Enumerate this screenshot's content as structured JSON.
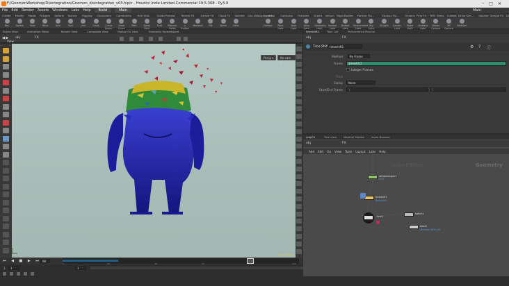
{
  "titlebar": {
    "text": "F:/GnomonWorkshop/Disintegration/Gnomon_disintegration_v03.hiplc - Houdini Indie Limited-Commercial 19.5.368 - Py3.9"
  },
  "menubar": {
    "items": [
      "File",
      "Edit",
      "Render",
      "Assets",
      "Windows",
      "Labs",
      "Help"
    ],
    "desktop": "Build",
    "desktop2": "Main"
  },
  "right_header": {
    "main_label": "Main"
  },
  "shelf_tabs_left": [
    "Create",
    "Modify",
    "Model",
    "Polygon",
    "Deform",
    "Texture",
    "Rigging",
    "Characters",
    "Constraints",
    "Hair Utils",
    "Guide Process",
    "Terrain FX",
    "Simple FX",
    "Cloud FX",
    "Volume",
    "Gas Utils",
    "python"
  ],
  "shelf_tabs_right": [
    "Lights and...",
    "Collisions",
    "Particles",
    "Grains",
    "Vellum",
    "Rigid Bodies",
    "Particle Flu...",
    "Viscous Flu...",
    "Oceans",
    "Pyro FX",
    "FEM",
    "Wires",
    "Crowds",
    "Drive Sim...",
    "Volume",
    "Simple FX",
    "Legacy Pyr..."
  ],
  "shelf_tools_left": [
    "Box",
    "Sphere",
    "Tube",
    "Torus",
    "Grid",
    "Null",
    "Line",
    "Circle",
    "Curve Bezier",
    "Draw Curve",
    "Path",
    "Spray Paint",
    "Font",
    "Platonic Solids",
    "L-System",
    "Metaball",
    "File",
    "Spiral",
    "Helix"
  ],
  "shelf_tools_right": [
    "Camera",
    "Point Light",
    "Spot Light",
    "Area Light",
    "Geometry Light",
    "Volume Light",
    "Distant Light",
    "Environment Light",
    "Sky Light",
    "GI Light",
    "Caustic Light",
    "Portal Light",
    "Ambient Light",
    "Stereo Camera",
    "VR Camera",
    "Switcher"
  ],
  "pane_tabs_left": [
    "Scene View",
    "Animation Editor",
    "Render View",
    "Composite View",
    "Motion FX View",
    "Geometry Spreadsheet"
  ],
  "viewport": {
    "label": "View",
    "persp_button": "Persp ▾",
    "cam_button": "No cam ▾",
    "geo_label": "Geometry",
    "path_left": "obj",
    "path_right": "FX"
  },
  "param_tabs": [
    "timeshift1",
    "Take List",
    "Performance Monitor"
  ],
  "params": {
    "node_type": "Time Shift",
    "node_name": "timeshift1",
    "method_label": "Method",
    "method_value": "By Frame",
    "frame_label": "Frame",
    "frame_value": "$meshfs1",
    "integer_frames_label": "Integer Frames",
    "time_label": "Time",
    "clamp_label": "Clamp",
    "clamp_value": "None",
    "startend_label": "Start/End Frame",
    "startend_values": [
      "1",
      "1"
    ]
  },
  "net_tabs": [
    "/obj/FX",
    "Tree View",
    "Material Palette",
    "Asset Browser"
  ],
  "net_path": {
    "left": "obj",
    "right": "FX"
  },
  "net_menu": [
    "Add",
    "Edit",
    "Go",
    "View",
    "Tools",
    "Layout",
    "Labs",
    "Help"
  ],
  "net_watermark": "Indie Edition",
  "net_context": "Geometry",
  "nodes": [
    {
      "label": "attribwrangler1",
      "sub": "f1:N"
    },
    {
      "label": "timeshift1",
      "sub": "$meshfs1"
    },
    {
      "label": "fuse1",
      "sub": ""
    },
    {
      "label": "switch1",
      "sub": ""
    },
    {
      "label": "blast1",
      "sub": "@frame=$F*4.50"
    }
  ],
  "timeline": {
    "frame": "68",
    "start": "1",
    "end_left": "1",
    "end_a": "120",
    "end_b": "120",
    "ticks": [
      "1",
      "24",
      "48",
      "72",
      "96",
      "120"
    ],
    "keys_label": "0 keys, 0/0 channels",
    "key_all": "Key All Channels",
    "auto_update": "Auto Update",
    "status_path": "/obj/FX/exlum..."
  },
  "colors": {
    "accent": "#f07b1d",
    "geo_blue": "#1e1fa6",
    "frame_field": "#2f8c6e",
    "timeline_bar": "#1f5f8a"
  }
}
